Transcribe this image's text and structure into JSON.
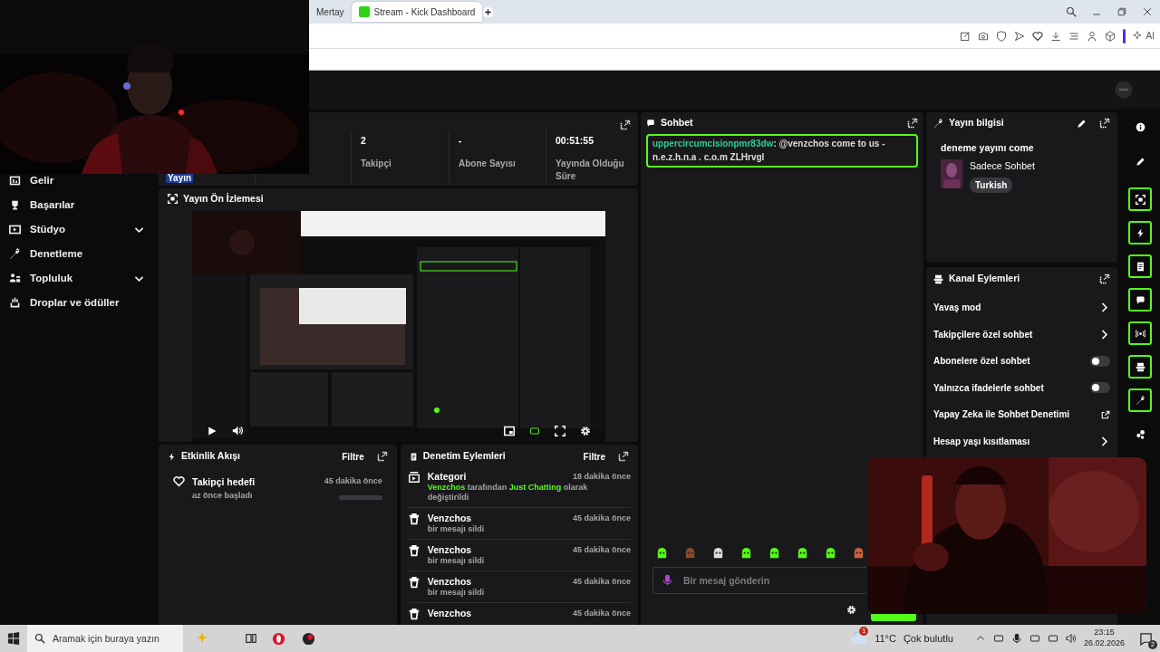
{
  "browser": {
    "tabs": [
      {
        "label": "Mertay",
        "selected": false
      },
      {
        "label": "Stream - Kick Dashboard",
        "selected": true
      }
    ],
    "ai_button": "AI"
  },
  "sidebar": {
    "items": [
      {
        "label": "Gelir",
        "expandable": false
      },
      {
        "label": "Başarılar",
        "expandable": false
      },
      {
        "label": "Stüdyo",
        "expandable": true
      },
      {
        "label": "Denetleme",
        "expandable": false
      },
      {
        "label": "Topluluk",
        "expandable": true
      },
      {
        "label": "Droplar ve ödüller",
        "expandable": false
      }
    ]
  },
  "stats": {
    "badge": "Yayın",
    "items": [
      {
        "value": "2",
        "label": "Takipçi"
      },
      {
        "value": "-",
        "label": "Abone Sayısı"
      },
      {
        "value": "00:51:55",
        "label": "Yayında Olduğu Süre"
      }
    ]
  },
  "preview": {
    "title": "Yayın Ön İzlemesi"
  },
  "activity": {
    "title": "Etkinlik Akışı",
    "filter": "Filtre",
    "events": [
      {
        "title": "Takipçi hedefi",
        "subtitle": "az önce başladı",
        "time": "45 dakika önce",
        "level": 0
      }
    ]
  },
  "moderation": {
    "title": "Denetim Eylemleri",
    "filter": "Filtre",
    "actions": [
      {
        "kind": "category",
        "title": "Kategori",
        "time": "18 dakika önce",
        "detail": [
          {
            "text": "Venzchos",
            "highlight": true
          },
          {
            "text": " tarafından ",
            "highlight": false
          },
          {
            "text": "Just Chatting",
            "highlight": true
          },
          {
            "text": " olarak değiştirildi",
            "highlight": false
          }
        ]
      },
      {
        "kind": "delete",
        "title": "Venzchos",
        "time": "45 dakika önce",
        "detail": [
          {
            "text": "bir mesajı sildi",
            "highlight": false
          }
        ]
      },
      {
        "kind": "delete",
        "title": "Venzchos",
        "time": "45 dakika önce",
        "detail": [
          {
            "text": "bir mesajı sildi",
            "highlight": false
          }
        ]
      },
      {
        "kind": "delete",
        "title": "Venzchos",
        "time": "45 dakika önce",
        "detail": [
          {
            "text": "bir mesajı sildi",
            "highlight": false
          }
        ]
      },
      {
        "kind": "delete",
        "title": "Venzchos",
        "time": "45 dakika önce"
      }
    ]
  },
  "chat": {
    "title": "Sohbet",
    "messages": [
      {
        "user": "uppercircumcisionpmr83dw",
        "text": ": @venzchos come to us - n.e.z.h.n.a . c.o.m ZLHrvgl",
        "highlighted": true
      }
    ],
    "placeholder": "Bir mesaj gönderin"
  },
  "stream_info": {
    "title": "Yayın bilgisi",
    "stream_title": "deneme yayını come",
    "category": "Sadece Sohbet",
    "tag": "Turkish"
  },
  "channel_actions": {
    "title": "Kanal Eylemleri",
    "items": [
      {
        "kind": "link",
        "label": "Yavaş mod"
      },
      {
        "kind": "link",
        "label": "Takipçilere özel sohbet"
      },
      {
        "kind": "toggle",
        "label": "Abonelere özel sohbet",
        "on": false
      },
      {
        "kind": "toggle",
        "label": "Yalnızca ifadelerle sohbet",
        "on": false
      },
      {
        "kind": "external",
        "label": "Yapay Zeka ile Sohbet Denetimi"
      },
      {
        "kind": "link",
        "label": "Hesap yaşı kısıtlaması"
      }
    ]
  },
  "rail": [
    {
      "outlined": false
    },
    {
      "outlined": false
    },
    {
      "outlined": true
    },
    {
      "outlined": true
    },
    {
      "outlined": true
    },
    {
      "outlined": true
    },
    {
      "outlined": true
    },
    {
      "outlined": true
    },
    {
      "outlined": true
    },
    {
      "outlined": false
    }
  ],
  "taskbar": {
    "search_placeholder": "Aramak için buraya yazın",
    "weather_badge": "1",
    "temperature": "11°C",
    "weather": "Çok bulutlu",
    "time": "23:15",
    "date": "26.02.2026",
    "notifications": "2"
  }
}
